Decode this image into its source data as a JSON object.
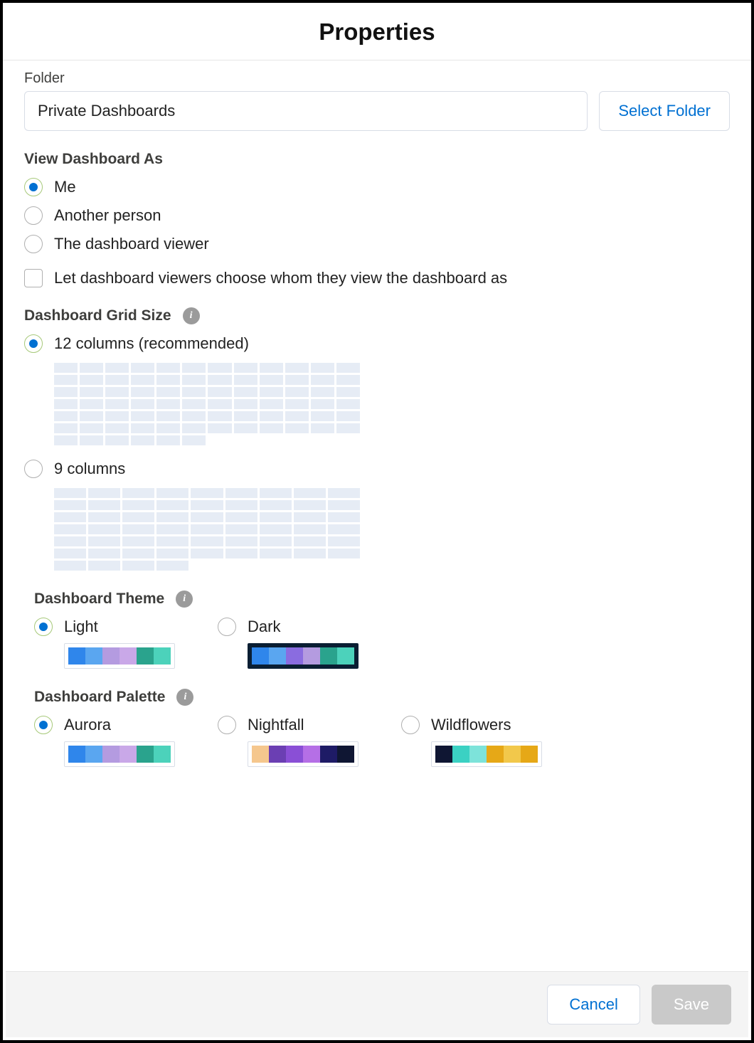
{
  "title": "Properties",
  "folder": {
    "label": "Folder",
    "value": "Private Dashboards",
    "select_button": "Select Folder"
  },
  "view_as": {
    "label": "View Dashboard As",
    "options": {
      "me": "Me",
      "another": "Another person",
      "viewer": "The dashboard viewer"
    },
    "selected": "me",
    "checkbox_label": "Let dashboard viewers choose whom they view the dashboard as",
    "checkbox_checked": false
  },
  "grid_size": {
    "label": "Dashboard Grid Size",
    "options": {
      "twelve": "12 columns (recommended)",
      "nine": "9 columns"
    },
    "selected": "twelve"
  },
  "theme": {
    "label": "Dashboard Theme",
    "options": {
      "light": "Light",
      "dark": "Dark"
    },
    "selected": "light",
    "swatches": {
      "light": [
        "#2f86eb",
        "#5aa6f0",
        "#b49be0",
        "#c9a8e8",
        "#2aa38d",
        "#4cd2bb"
      ],
      "dark": [
        "#2f86eb",
        "#5aa6f0",
        "#8a6ce0",
        "#b49be0",
        "#2aa38d",
        "#4cd2bb"
      ]
    }
  },
  "palette": {
    "label": "Dashboard Palette",
    "options": {
      "aurora": "Aurora",
      "nightfall": "Nightfall",
      "wildflowers": "Wildflowers"
    },
    "selected": "aurora",
    "swatches": {
      "aurora": [
        "#2f86eb",
        "#5aa6f0",
        "#b49be0",
        "#c9a8e8",
        "#2aa38d",
        "#4cd2bb"
      ],
      "nightfall": [
        "#f5c78e",
        "#6b3fb3",
        "#8a4fd6",
        "#b56fe6",
        "#1e1b66",
        "#0f1633"
      ],
      "wildflowers": [
        "#0f1633",
        "#3bd1c3",
        "#7de3da",
        "#e6a817",
        "#f2c84b",
        "#e6a817"
      ]
    }
  },
  "footer": {
    "cancel": "Cancel",
    "save": "Save"
  }
}
